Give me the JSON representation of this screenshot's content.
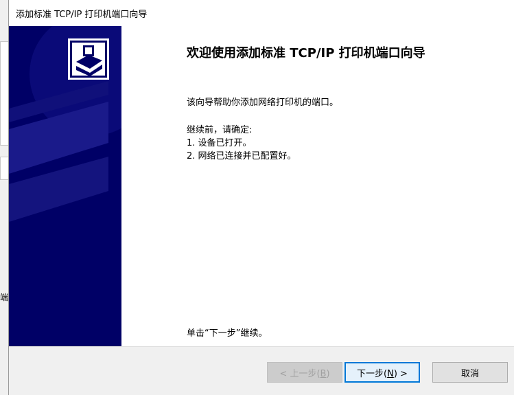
{
  "window": {
    "title": "添加标准 TCP/IP 打印机端口向导",
    "background_fragment": "端"
  },
  "welcome": {
    "heading": "欢迎使用添加标准 TCP/IP 打印机端口向导",
    "intro": "该向导帮助你添加网络打印机的端口。",
    "before_label": "继续前，请确定:",
    "items": [
      "1.  设备已打开。",
      "2.  网络已连接并已配置好。"
    ],
    "footer": "单击“下一步”继续。"
  },
  "buttons": {
    "back": {
      "prefix": "< 上一步(",
      "key": "B",
      "suffix": ")"
    },
    "next": {
      "prefix": "下一步(",
      "key": "N",
      "suffix": ") >"
    },
    "cancel": "取消"
  },
  "colors": {
    "banner": "#000066",
    "default_button_border": "#0078d7"
  },
  "icons": {
    "banner_icon": "printer-icon"
  }
}
